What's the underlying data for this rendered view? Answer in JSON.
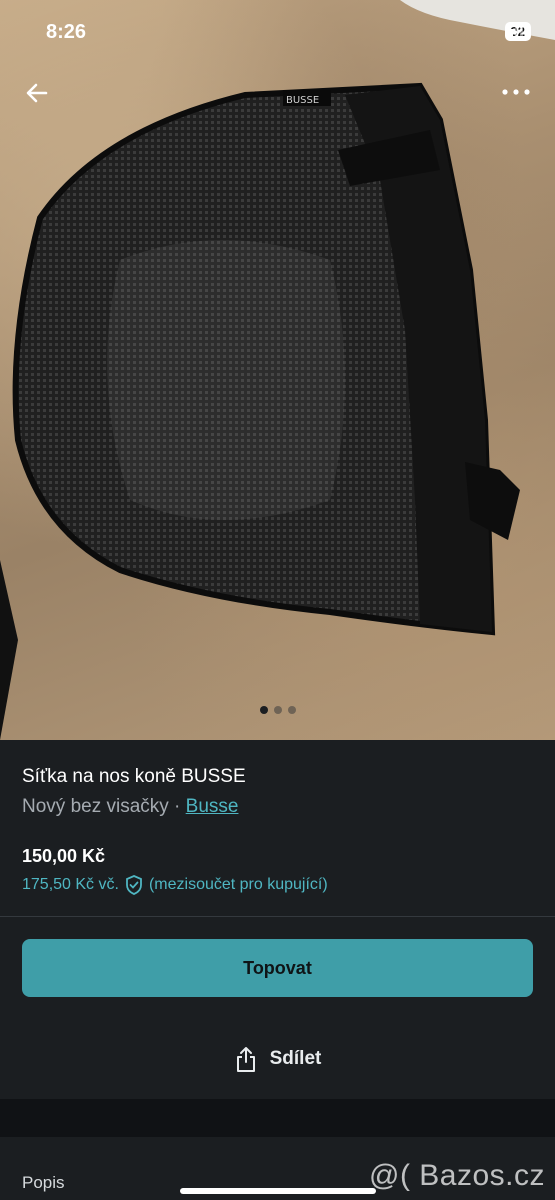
{
  "status": {
    "time": "8:26",
    "battery": "92"
  },
  "photo": {
    "icons": [
      "arrow-left-icon",
      "more-horizontal-icon"
    ],
    "page_count": 3,
    "active_page": 1
  },
  "listing": {
    "title": "Síťka na nos koně BUSSE",
    "condition": "Nový bez visačky ·",
    "brand": "Busse",
    "price": "150,00 Kč",
    "price_with_fee": "175,50 Kč vč.",
    "price_note": "(mezisoučet pro kupující)"
  },
  "actions": {
    "primary_label": "Topovat",
    "share_label": "Sdílet"
  },
  "section": {
    "label": "Popis"
  },
  "watermark": "@( Bazos.cz",
  "colors": {
    "accent": "#3f9ea8",
    "link": "#4fb6c2",
    "background": "#1b1e21"
  }
}
